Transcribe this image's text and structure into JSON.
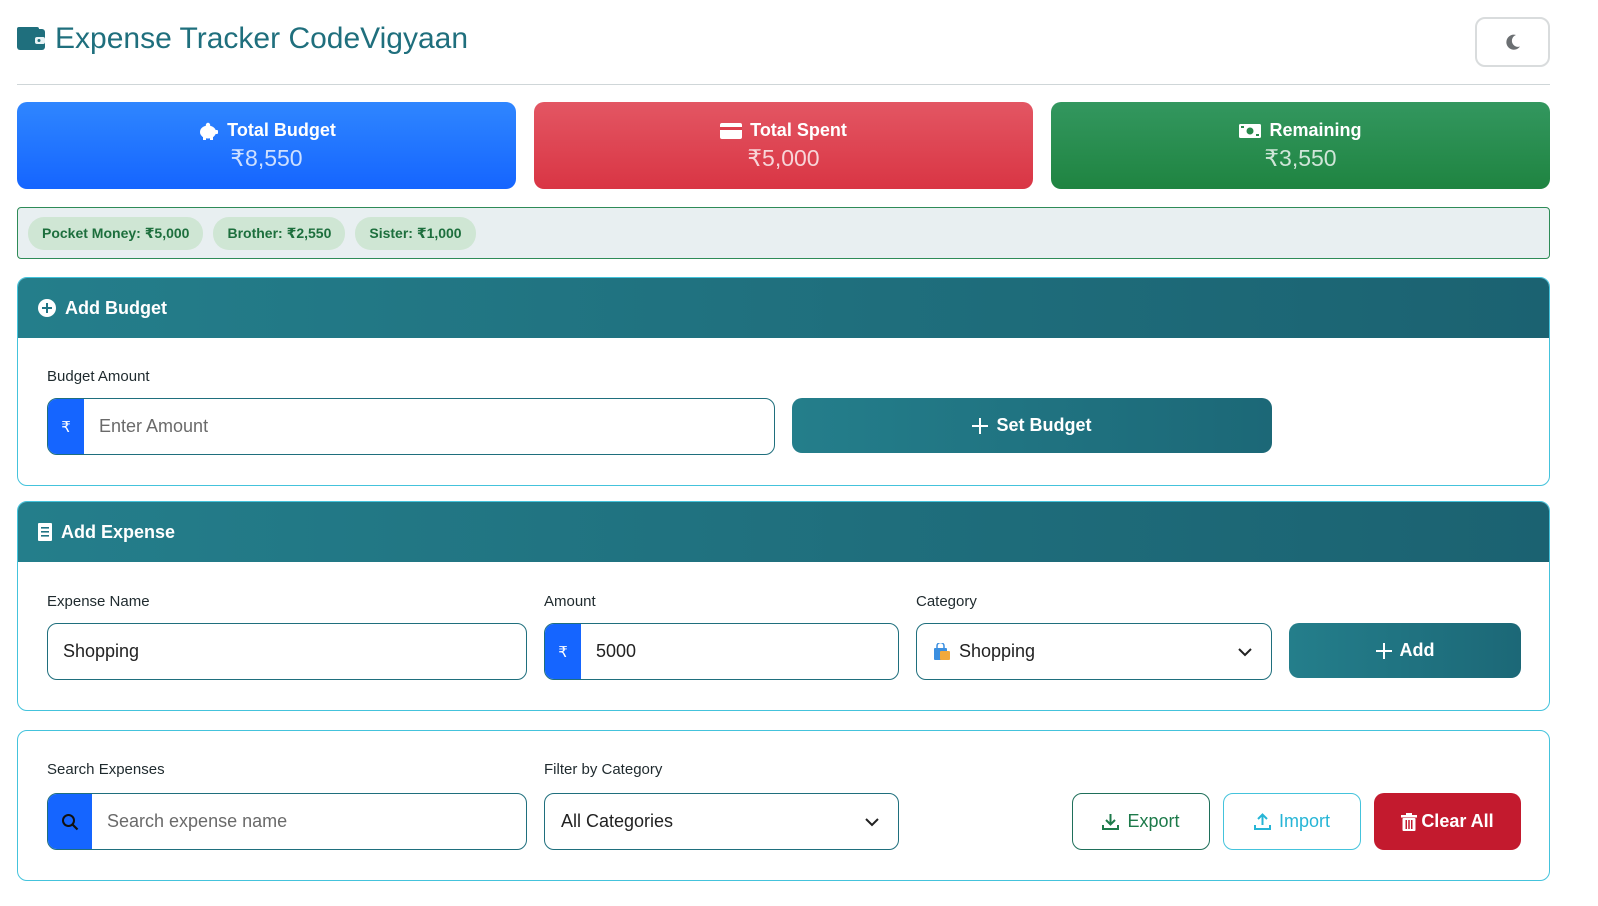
{
  "header": {
    "title": "Expense Tracker CodeVigyaan",
    "theme_icon": "moon-icon"
  },
  "summary": {
    "budget": {
      "label": "Total Budget",
      "value": "₹8,550",
      "icon": "piggy-bank-icon",
      "color": "#1f6fff"
    },
    "spent": {
      "label": "Total Spent",
      "value": "₹5,000",
      "icon": "credit-card-icon",
      "color": "#dd3e4c"
    },
    "remaining": {
      "label": "Remaining",
      "value": "₹3,550",
      "icon": "cash-icon",
      "color": "#27894b"
    }
  },
  "sources": [
    {
      "label": "Pocket Money: ₹5,000"
    },
    {
      "label": "Brother: ₹2,550"
    },
    {
      "label": "Sister: ₹1,000"
    }
  ],
  "add_budget": {
    "title": "Add Budget",
    "amount_label": "Budget Amount",
    "currency_symbol": "₹",
    "amount_placeholder": "Enter Amount",
    "button_label": "Set Budget"
  },
  "add_expense": {
    "title": "Add Expense",
    "name_label": "Expense Name",
    "name_value": "Shopping",
    "amount_label": "Amount",
    "currency_symbol": "₹",
    "amount_value": "5000",
    "category_label": "Category",
    "category_value": "Shopping",
    "category_icon": "shopping-bag-icon",
    "button_label": "Add"
  },
  "filters": {
    "search_label": "Search Expenses",
    "search_placeholder": "Search expense name",
    "filter_label": "Filter by Category",
    "filter_value": "All Categories",
    "export_label": "Export",
    "import_label": "Import",
    "clear_label": "Clear All"
  },
  "colors": {
    "accent": "#1f6f7d",
    "primary_blue": "#1565ff",
    "danger": "#c31a2e"
  }
}
